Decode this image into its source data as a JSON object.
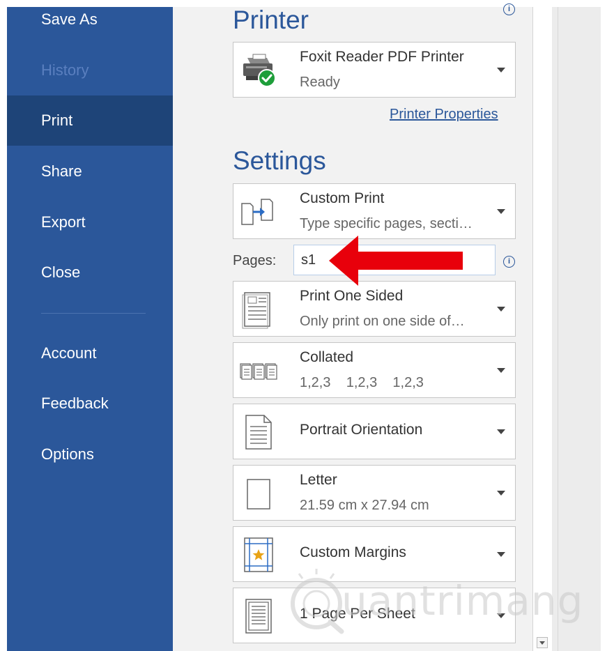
{
  "sidebar": {
    "items": [
      {
        "label": "Save As"
      },
      {
        "label": "History"
      },
      {
        "label": "Print"
      },
      {
        "label": "Share"
      },
      {
        "label": "Export"
      },
      {
        "label": "Close"
      },
      {
        "label": "Account"
      },
      {
        "label": "Feedback"
      },
      {
        "label": "Options"
      }
    ]
  },
  "printer": {
    "title": "Printer",
    "name": "Foxit Reader PDF Printer",
    "status": "Ready",
    "properties_link": "Printer Properties"
  },
  "settings": {
    "title": "Settings",
    "print_range": {
      "primary": "Custom Print",
      "secondary": "Type specific pages, secti…"
    },
    "pages": {
      "label": "Pages:",
      "value": "s1"
    },
    "sides": {
      "primary": "Print One Sided",
      "secondary": "Only print on one side of…"
    },
    "collation": {
      "primary": "Collated",
      "secondary": "1,2,3    1,2,3    1,2,3"
    },
    "orientation": {
      "primary": "Portrait Orientation"
    },
    "paper": {
      "primary": "Letter",
      "secondary": "21.59 cm x 27.94 cm"
    },
    "margins": {
      "primary": "Custom Margins"
    },
    "per_sheet": {
      "primary": "1 Page Per Sheet"
    }
  },
  "watermark": {
    "text": "uantrimang"
  },
  "colors": {
    "sidebar": "#2b579a",
    "sidebar_active": "#1e4478",
    "accent": "#2b579a",
    "annotation": "#e8000b",
    "status_ok": "#1e9e3a"
  }
}
